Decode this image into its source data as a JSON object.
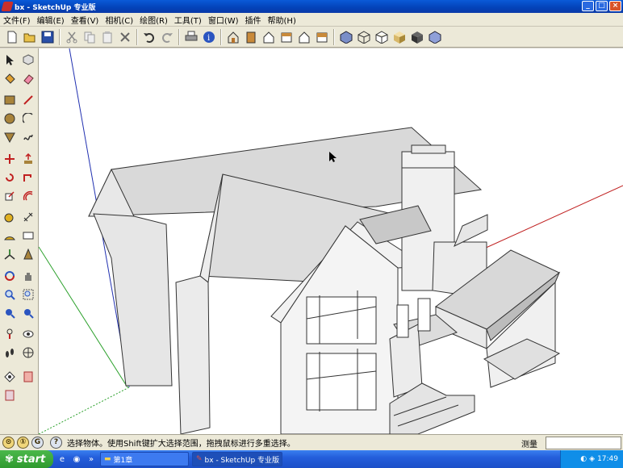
{
  "window": {
    "title": "bx - SketchUp 专业版",
    "min": "_",
    "max": "□",
    "close": "×"
  },
  "menu": [
    "文件(F)",
    "编辑(E)",
    "查看(V)",
    "相机(C)",
    "绘图(R)",
    "工具(T)",
    "窗口(W)",
    "插件",
    "帮助(H)"
  ],
  "toolbar_icons": [
    "new-icon",
    "open-icon",
    "save-icon",
    "cut-icon",
    "copy-icon",
    "paste-icon",
    "erase-icon",
    "undo-icon",
    "redo-icon",
    "print-icon",
    "model-info-icon",
    "iso-view-icon",
    "top-view-icon",
    "front-view-icon",
    "right-view-icon",
    "back-view-icon",
    "left-view-icon",
    "xray-icon",
    "wireframe-icon",
    "hidden-line-icon",
    "shaded-icon",
    "shaded-textures-icon",
    "monochrome-icon"
  ],
  "status": {
    "hint": "选择物体。使用Shift键扩大选择范围，拖拽鼠标进行多重选择。",
    "measure_label": "测量",
    "measure_value": ""
  },
  "taskbar": {
    "start": "start",
    "tasks": [
      "第1章",
      "bx - SketchUp 专业版"
    ],
    "clock": "17:49"
  }
}
